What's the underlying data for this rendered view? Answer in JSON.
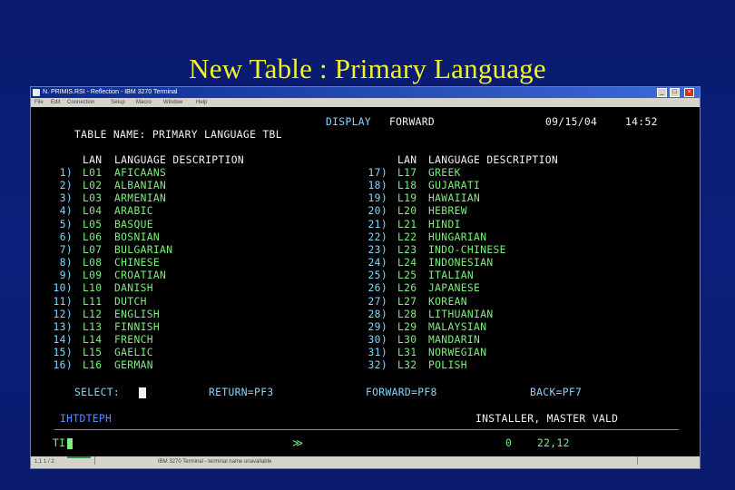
{
  "slide_title": "New Table : Primary Language",
  "window": {
    "title": "N. PRIMIS.RSI - Reflection - IBM 3270 Terminal",
    "menu": [
      "File",
      "Edit",
      "Connection",
      "Setup",
      "Macro",
      "Window",
      "Help"
    ]
  },
  "terminal": {
    "header_display": "DISPLAY",
    "header_forward": "FORWARD",
    "date": "09/15/04",
    "time": "14:52",
    "table_name": "TABLE NAME: PRIMARY LANGUAGE TBL",
    "col_lan": "LAN",
    "col_desc": "LANGUAGE DESCRIPTION",
    "left_rows": [
      {
        "num": "1)",
        "code": "L01",
        "desc": "AFICAANS"
      },
      {
        "num": "2)",
        "code": "L02",
        "desc": "ALBANIAN"
      },
      {
        "num": "3)",
        "code": "L03",
        "desc": "ARMENIAN"
      },
      {
        "num": "4)",
        "code": "L04",
        "desc": "ARABIC"
      },
      {
        "num": "5)",
        "code": "L05",
        "desc": "BASQUE"
      },
      {
        "num": "6)",
        "code": "L06",
        "desc": "BOSNIAN"
      },
      {
        "num": "7)",
        "code": "L07",
        "desc": "BULGARIAN"
      },
      {
        "num": "8)",
        "code": "L08",
        "desc": "CHINESE"
      },
      {
        "num": "9)",
        "code": "L09",
        "desc": "CROATIAN"
      },
      {
        "num": "10)",
        "code": "L10",
        "desc": "DANISH"
      },
      {
        "num": "11)",
        "code": "L11",
        "desc": "DUTCH"
      },
      {
        "num": "12)",
        "code": "L12",
        "desc": "ENGLISH"
      },
      {
        "num": "13)",
        "code": "L13",
        "desc": "FINNISH"
      },
      {
        "num": "14)",
        "code": "L14",
        "desc": "FRENCH"
      },
      {
        "num": "15)",
        "code": "L15",
        "desc": "GAELIC"
      },
      {
        "num": "16)",
        "code": "L16",
        "desc": "GERMAN"
      }
    ],
    "right_rows": [
      {
        "num": "17)",
        "code": "L17",
        "desc": "GREEK"
      },
      {
        "num": "18)",
        "code": "L18",
        "desc": "GUJARATI"
      },
      {
        "num": "19)",
        "code": "L19",
        "desc": "HAWAIIAN"
      },
      {
        "num": "20)",
        "code": "L20",
        "desc": "HEBREW"
      },
      {
        "num": "21)",
        "code": "L21",
        "desc": "HINDI"
      },
      {
        "num": "22)",
        "code": "L22",
        "desc": "HUNGARIAN"
      },
      {
        "num": "23)",
        "code": "L23",
        "desc": "INDO-CHINESE"
      },
      {
        "num": "24)",
        "code": "L24",
        "desc": "INDONESIAN"
      },
      {
        "num": "25)",
        "code": "L25",
        "desc": "ITALIAN"
      },
      {
        "num": "26)",
        "code": "L26",
        "desc": "JAPANESE"
      },
      {
        "num": "27)",
        "code": "L27",
        "desc": "KOREAN"
      },
      {
        "num": "28)",
        "code": "L28",
        "desc": "LITHUANIAN"
      },
      {
        "num": "29)",
        "code": "L29",
        "desc": "MALAYSIAN"
      },
      {
        "num": "30)",
        "code": "L30",
        "desc": "MANDARIN"
      },
      {
        "num": "31)",
        "code": "L31",
        "desc": "NORWEGIAN"
      },
      {
        "num": "32)",
        "code": "L32",
        "desc": "POLISH"
      }
    ],
    "select_label": "SELECT:",
    "return_key": "RETURN=PF3",
    "forward_key": "FORWARD=PF8",
    "back_key": "BACK=PF7",
    "program_id": "IHTDTEPH",
    "installer": "INSTALLER, MASTER VALD",
    "command_prefix": "TI",
    "oia_arrow": "≫",
    "oia_status": "0",
    "oia_position": "22,12"
  },
  "statusbar": {
    "left": "1,1  1 / 2",
    "center": "IBM 3270 Terminal - terminal name unavailable"
  },
  "colors": {
    "slide_bg": "#0a1a6e",
    "title": "#f2f22a",
    "terminal_cyan": "#7fd9ff",
    "terminal_green": "#7cf07c",
    "terminal_blue": "#5a8cff"
  }
}
